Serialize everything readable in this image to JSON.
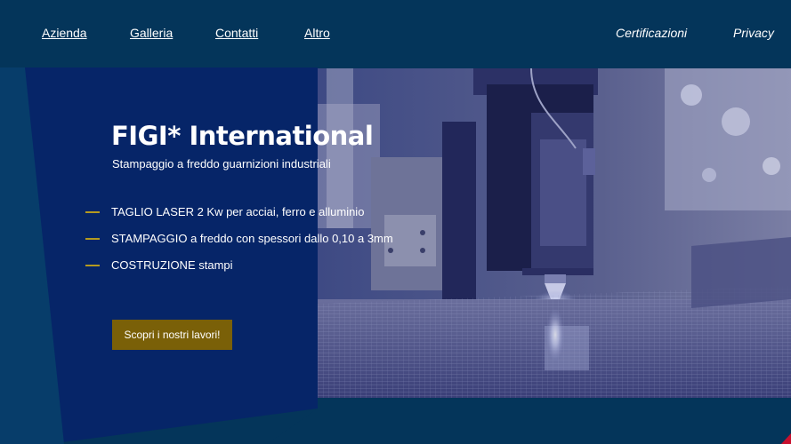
{
  "nav": {
    "left": [
      "Azienda",
      "Galleria",
      "Contatti",
      "Altro"
    ],
    "right": [
      "Certificazioni",
      "Privacy"
    ]
  },
  "hero": {
    "title": "FIGI* International",
    "subtitle": "Stampaggio a freddo guarnizioni industriali",
    "bullets": [
      "TAGLIO LASER 2 Kw per acciai, ferro e alluminio",
      "STAMPAGGIO a freddo con spessori dallo 0,10 a 3mm",
      "COSTRUZIONE stampi"
    ],
    "cta_label": "Scopri i nostri lavori!"
  },
  "colors": {
    "background": "#04355a",
    "panel": "#062568",
    "accent_gold": "#b49a20",
    "cta_bg": "#7a6008",
    "corner_accent": "#c8102e"
  },
  "image": {
    "icon": "laser-cutting-machine-photo"
  }
}
